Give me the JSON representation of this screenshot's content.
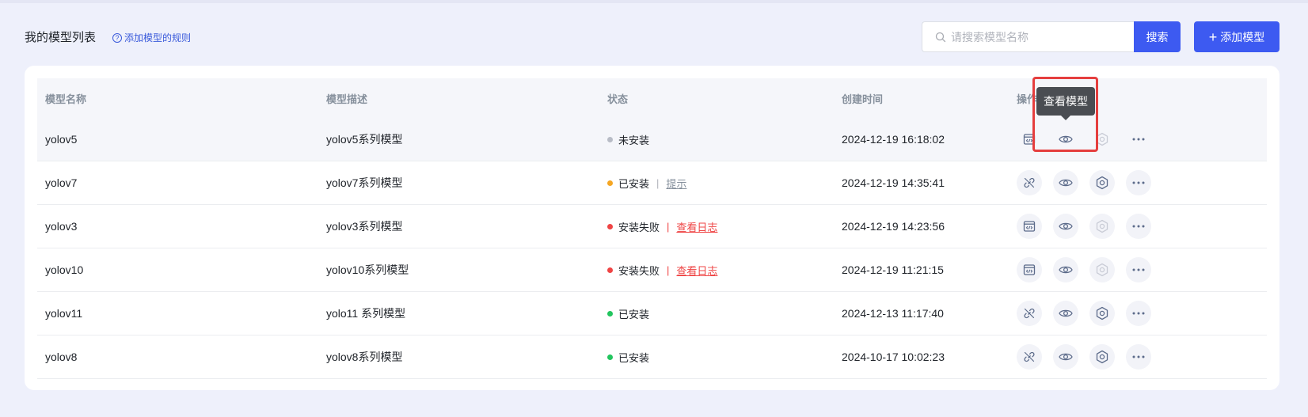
{
  "header": {
    "title": "我的模型列表",
    "rules_link": "添加模型的规则",
    "search_placeholder": "请搜索模型名称",
    "search_button": "搜索",
    "add_button": "添加模型"
  },
  "table": {
    "columns": [
      "模型名称",
      "模型描述",
      "状态",
      "创建时间",
      "操作"
    ],
    "rows": [
      {
        "name": "yolov5",
        "desc": "yolov5系列模型",
        "status": "未安装",
        "status_color": "#b8bcc6",
        "extra": "",
        "extra_style": "",
        "time": "2024-12-19 16:18:02",
        "first_icon": "code-window-icon",
        "settings_enabled": false
      },
      {
        "name": "yolov7",
        "desc": "yolov7系列模型",
        "status": "已安装",
        "status_color": "#f5a623",
        "extra": "提示",
        "extra_style": "gray",
        "time": "2024-12-19 14:35:41",
        "first_icon": "unlink-icon",
        "settings_enabled": true
      },
      {
        "name": "yolov3",
        "desc": "yolov3系列模型",
        "status": "安装失败",
        "status_color": "#ef4444",
        "extra": "查看日志",
        "extra_style": "red",
        "time": "2024-12-19 14:23:56",
        "first_icon": "code-window-icon",
        "settings_enabled": false
      },
      {
        "name": "yolov10",
        "desc": "yolov10系列模型",
        "status": "安装失败",
        "status_color": "#ef4444",
        "extra": "查看日志",
        "extra_style": "red",
        "time": "2024-12-19 11:21:15",
        "first_icon": "code-window-icon",
        "settings_enabled": false
      },
      {
        "name": "yolov11",
        "desc": "yolo11 系列模型",
        "status": "已安装",
        "status_color": "#22c55e",
        "extra": "",
        "extra_style": "",
        "time": "2024-12-13 11:17:40",
        "first_icon": "unlink-icon",
        "settings_enabled": true
      },
      {
        "name": "yolov8",
        "desc": "yolov8系列模型",
        "status": "已安装",
        "status_color": "#22c55e",
        "extra": "",
        "extra_style": "",
        "time": "2024-10-17 10:02:23",
        "first_icon": "unlink-icon",
        "settings_enabled": true
      }
    ]
  },
  "tooltip": "查看模型",
  "colors": {
    "primary": "#3d5af1",
    "background": "#eef0fb",
    "highlight": "#e53e3e"
  }
}
